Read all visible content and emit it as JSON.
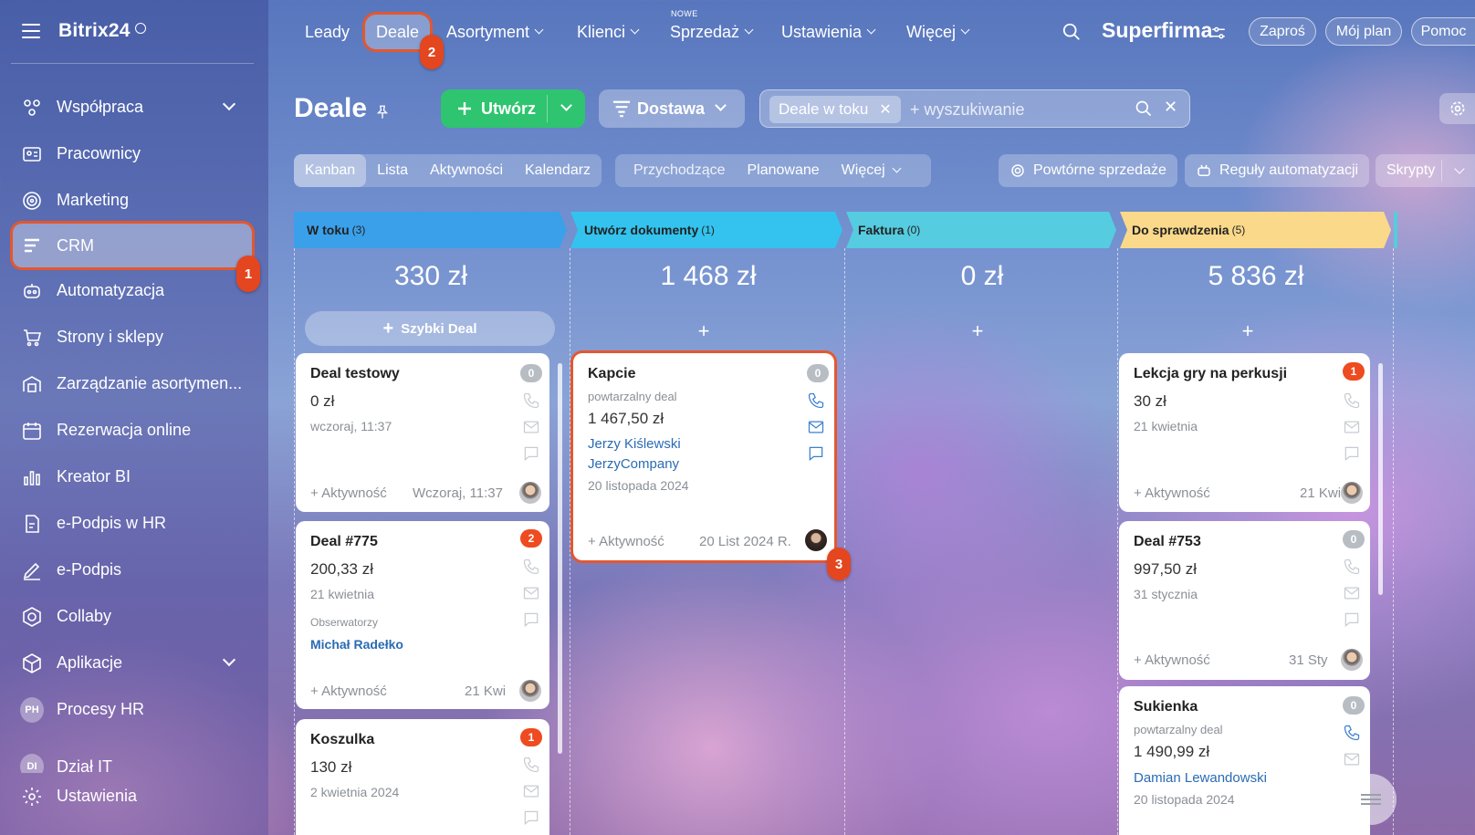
{
  "sidebar": {
    "brand": "Bitrix24",
    "items": [
      {
        "label": "Współpraca",
        "icon": "collaboration-icon",
        "has_arrow": true
      },
      {
        "label": "Pracownicy",
        "icon": "employees-icon"
      },
      {
        "label": "Marketing",
        "icon": "marketing-icon"
      },
      {
        "label": "CRM",
        "icon": "crm-icon",
        "active": true
      },
      {
        "label": "Automatyzacja",
        "icon": "automation-icon"
      },
      {
        "label": "Strony i sklepy",
        "icon": "cart-icon"
      },
      {
        "label": "Zarządzanie asortymen...",
        "icon": "warehouse-icon"
      },
      {
        "label": "Rezerwacja online",
        "icon": "calendar-icon"
      },
      {
        "label": "Kreator BI",
        "icon": "bi-chart-icon"
      },
      {
        "label": "e-Podpis w HR",
        "icon": "document-sign-icon"
      },
      {
        "label": "e-Podpis",
        "icon": "pen-icon"
      },
      {
        "label": "Collaby",
        "icon": "collaby-icon"
      },
      {
        "label": "Aplikacje",
        "icon": "apps-icon",
        "has_arrow": true
      },
      {
        "label": "Procesy HR",
        "icon": "ph-badge-icon",
        "badge": "PH"
      },
      {
        "label": "Dział IT",
        "icon": "di-badge-icon",
        "badge": "DI"
      },
      {
        "label": "Ustawienia",
        "icon": "settings-icon"
      }
    ]
  },
  "topnav": {
    "items": [
      "Leady",
      "Deale",
      "Asortyment",
      "Klienci",
      "Sprzedaż",
      "Ustawienia",
      "Więcej"
    ],
    "new_tag": "NOWE",
    "company": "Superfirma",
    "invite": "Zaproś",
    "plan": "Mój plan",
    "help": "Pomoc"
  },
  "toolbar": {
    "title": "Deale",
    "create": "Utwórz",
    "pipeline": "Dostawa",
    "filter_chip": "Deale w toku",
    "search_placeholder": "+ wyszukiwanie"
  },
  "views": {
    "modes": [
      "Kanban",
      "Lista",
      "Aktywności",
      "Kalendarz"
    ],
    "active_mode": "Kanban",
    "filters": [
      "Przychodzące",
      "Planowane",
      "Więcej"
    ],
    "repeat_sales": "Powtórne sprzedaże",
    "automation_rules": "Reguły automatyzacji",
    "scripts": "Skrypty"
  },
  "markers": [
    "1",
    "2",
    "3"
  ],
  "kanban": {
    "quick_deal": "Szybki Deal",
    "columns": [
      {
        "name": "W toku",
        "count": "(3)",
        "total": "330 zł",
        "color": "#3aa0ea"
      },
      {
        "name": "Utwórz dokumenty",
        "count": "(1)",
        "total": "1 468 zł",
        "color": "#33c3ee"
      },
      {
        "name": "Faktura",
        "count": "(0)",
        "total": "0 zł",
        "color": "#55cce0"
      },
      {
        "name": "Do sprawdzenia",
        "count": "(5)",
        "total": "5 836 zł",
        "color": "#fbd98a"
      }
    ],
    "cards": {
      "deal_testowy": {
        "title": "Deal testowy",
        "amount": "0 zł",
        "date": "wczoraj, 11:37",
        "activity": "+ Aktywność",
        "activity_date": "Wczoraj, 11:37",
        "badge": "0"
      },
      "deal_775": {
        "title": "Deal #775",
        "amount": "200,33 zł",
        "date": "21 kwietnia",
        "observers_label": "Obserwatorzy",
        "observer": "Michał Radełko",
        "activity": "+ Aktywność",
        "activity_date": "21 Kwi",
        "badge": "2"
      },
      "koszulka": {
        "title": "Koszulka",
        "amount": "130 zł",
        "date": "2 kwietnia 2024",
        "badge": "1"
      },
      "kapcie": {
        "title": "Kapcie",
        "subtitle": "powtarzalny deal",
        "amount": "1 467,50 zł",
        "contact": "Jerzy Kiślewski",
        "company": "JerzyCompany",
        "date": "20 listopada 2024",
        "activity": "+ Aktywność",
        "activity_date": "20 List 2024 R.",
        "badge": "0"
      },
      "lekcja": {
        "title": "Lekcja gry na perkusji",
        "amount": "30 zł",
        "date": "21 kwietnia",
        "activity": "+ Aktywność",
        "activity_date": "21 Kwi",
        "badge": "1"
      },
      "deal_753": {
        "title": "Deal #753",
        "amount": "997,50 zł",
        "date": "31 stycznia",
        "activity": "+ Aktywność",
        "activity_date": "31 Sty",
        "badge": "0"
      },
      "sukienka": {
        "title": "Sukienka",
        "subtitle": "powtarzalny deal",
        "amount": "1 490,99 zł",
        "contact": "Damian Lewandowski",
        "date": "20 listopada 2024",
        "badge": "0"
      }
    }
  },
  "colors": {
    "accent_green": "#2fc46f",
    "highlight": "#e4572e",
    "badge_red": "#ee4b20",
    "link_blue": "#2a6bb3"
  }
}
